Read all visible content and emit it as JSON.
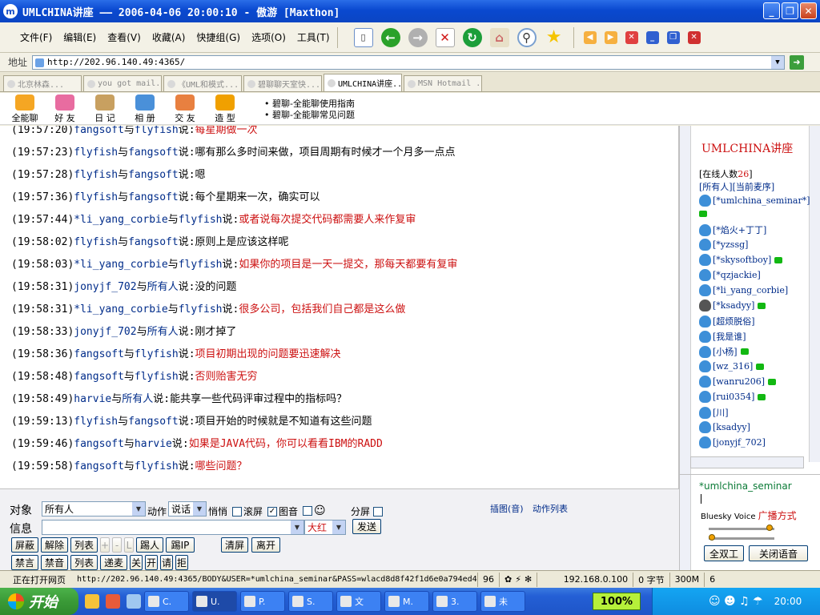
{
  "window": {
    "title": "UMLCHINA讲座 —— 2006-04-06 20:00:10 - 傲游 [Maxthon]"
  },
  "menu": [
    "文件(F)",
    "编辑(E)",
    "查看(V)",
    "收藏(A)",
    "快捷组(G)",
    "选项(O)",
    "工具(T)"
  ],
  "address": {
    "label": "地址",
    "url": "http://202.96.140.49:4365/"
  },
  "tabs": [
    "北京林森...",
    "you got mail...",
    "《UML和模式...",
    "碧聊聊天室快...",
    "UMLCHINA讲座...",
    "MSN Hotmail ..."
  ],
  "apptools": [
    "全能聊",
    "好 友",
    "日 记",
    "相 册",
    "交 友",
    "造 型"
  ],
  "guides": [
    "碧聊-全能聊使用指南",
    "碧聊-全能聊常见问题"
  ],
  "chat": [
    {
      "time": "(19:57:20)",
      "from": "fangsoft",
      "to": "flyfish",
      "text": "每星期做一次",
      "red": true
    },
    {
      "time": "(19:57:23)",
      "from": "flyfish",
      "to": "fangsoft",
      "text": "哪有那么多时间来做，项目周期有时候才一个月多一点点",
      "red": false
    },
    {
      "time": "(19:57:28)",
      "from": "flyfish",
      "to": "fangsoft",
      "text": "嗯",
      "red": false
    },
    {
      "time": "(19:57:36)",
      "from": "flyfish",
      "to": "fangsoft",
      "text": "每个星期来一次，确实可以",
      "red": false
    },
    {
      "time": "(19:57:44)",
      "from": "*li_yang_corbie",
      "to": "flyfish",
      "text": "或者说每次提交代码都需要人来作复审",
      "red": true
    },
    {
      "time": "(19:58:02)",
      "from": "flyfish",
      "to": "fangsoft",
      "text": "原则上是应该这样呢",
      "red": false
    },
    {
      "time": "(19:58:03)",
      "from": "*li_yang_corbie",
      "to": "flyfish",
      "text": "如果你的项目是一天一提交，那每天都要有复审",
      "red": true
    },
    {
      "time": "(19:58:31)",
      "from": "jonyjf_702",
      "to": "所有人",
      "text": "没的问题",
      "red": false
    },
    {
      "time": "(19:58:31)",
      "from": "*li_yang_corbie",
      "to": "flyfish",
      "text": "很多公司，包括我们自己都是这么做",
      "red": true
    },
    {
      "time": "(19:58:33)",
      "from": "jonyjf_702",
      "to": "所有人",
      "text": "刚才掉了",
      "red": false
    },
    {
      "time": "(19:58:36)",
      "from": "fangsoft",
      "to": "flyfish",
      "text": "项目初期出现的问题要迅速解决",
      "red": true
    },
    {
      "time": "(19:58:48)",
      "from": "fangsoft",
      "to": "flyfish",
      "text": "否则贻害无穷",
      "red": true
    },
    {
      "time": "(19:58:49)",
      "from": "harvie",
      "to": "所有人",
      "text": "能共享一些代码评审过程中的指标吗？",
      "red": false
    },
    {
      "time": "(19:59:13)",
      "from": "flyfish",
      "to": "fangsoft",
      "text": "项目开始的时候就是不知道有这些问题",
      "red": false
    },
    {
      "time": "(19:59:46)",
      "from": "fangsoft",
      "to": "harvie",
      "text": "如果是JAVA代码，你可以看看IBM的RADD",
      "red": true
    },
    {
      "time": "(19:59:58)",
      "from": "fangsoft",
      "to": "flyfish",
      "text": "哪些问题？",
      "red": true
    }
  ],
  "chat_labels": {
    "and": "与",
    "said": "说:"
  },
  "sidebar": {
    "title": "UMLCHINA讲座",
    "online_prefix": "[在线人数",
    "online_count": "26",
    "online_suffix": "]",
    "links": "[所有人][当前麦序]",
    "users": [
      {
        "name": "[*umlchina_seminar*]",
        "phone": true
      },
      {
        "name": "[*焰火+丁丁]",
        "phone": false
      },
      {
        "name": "[*yzssg]",
        "phone": false
      },
      {
        "name": "[*skysoftboy]",
        "phone": true
      },
      {
        "name": "[*qzjackie]",
        "phone": false
      },
      {
        "name": "[*li_yang_corbie]",
        "phone": false
      },
      {
        "name": "[*ksadyy]",
        "phone": true
      },
      {
        "name": "[超烦脱俗]",
        "phone": false
      },
      {
        "name": "[我是谁]",
        "phone": false
      },
      {
        "name": "[小杨]",
        "phone": true
      },
      {
        "name": "[wz_316]",
        "phone": true
      },
      {
        "name": "[wanru206]",
        "phone": true
      },
      {
        "name": "[rui0354]",
        "phone": true
      },
      {
        "name": "[川]",
        "phone": false
      },
      {
        "name": "[ksadyy]",
        "phone": false
      },
      {
        "name": "[jonyjf_702]",
        "phone": false
      }
    ]
  },
  "input": {
    "target_label": "对象",
    "target_value": "所有人",
    "action_label": "动作",
    "action_value": "说话",
    "whisper": "悄悄",
    "scroll": "滚屏",
    "image": "图音",
    "split": "分屏",
    "info_label": "信息",
    "color_value": "大红",
    "send": "发送",
    "insert_link": "插图(音)",
    "action_list": "动作列表",
    "btn_row1": [
      "屏蔽",
      "解除",
      "列表",
      "+",
      "-",
      "L",
      "踢人",
      "踢IP"
    ],
    "clear": "清屏",
    "leave": "离开",
    "btn_row2": [
      "禁言",
      "禁音",
      "列表",
      "递麦",
      "关",
      "开",
      "请",
      "拒"
    ]
  },
  "voice": {
    "name": "*umlchina_seminar",
    "brand": "Bluesky Voice",
    "mode": "广播方式",
    "duplex": "全双工",
    "close_voice": "关闭语音"
  },
  "status": {
    "text": "正在打开网页",
    "url": "http://202.96.140.49:4365/BODY&USER=*umlchina_seminar&PASS=wlacd8d8f42f1d6e0a794ed4",
    "count": "96",
    "ip": "192.168.0.100",
    "bytes": "0 字节",
    "mem": "300M",
    "num": "6"
  },
  "taskbar": {
    "start": "开始",
    "tasks": [
      "C.",
      "U.",
      "P.",
      "S.",
      "文",
      "M.",
      "3.",
      "未"
    ],
    "zoom": "100%",
    "clock": "20:00"
  }
}
